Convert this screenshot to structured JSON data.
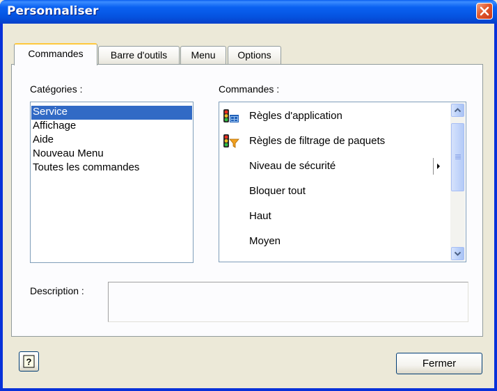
{
  "window": {
    "title": "Personnaliser"
  },
  "tabs": [
    {
      "label": "Commandes",
      "active": true
    },
    {
      "label": "Barre d'outils",
      "active": false
    },
    {
      "label": "Menu",
      "active": false
    },
    {
      "label": "Options",
      "active": false
    }
  ],
  "categories": {
    "label": "Catégories :",
    "items": [
      "Service",
      "Affichage",
      "Aide",
      "Nouveau Menu",
      "Toutes les commandes"
    ],
    "selected": "Service"
  },
  "commands": {
    "label": "Commandes :",
    "items": [
      {
        "label": "Règles d'application",
        "icon": "application-rules-icon"
      },
      {
        "label": "Règles de filtrage de paquets",
        "icon": "packet-filter-icon"
      },
      {
        "label": "Niveau de sécurité",
        "icon": "",
        "submenu": true
      },
      {
        "label": "Bloquer tout",
        "icon": ""
      },
      {
        "label": "Haut",
        "icon": ""
      },
      {
        "label": "Moyen",
        "icon": ""
      }
    ]
  },
  "description": {
    "label": "Description :",
    "value": ""
  },
  "buttons": {
    "help_icon": "help-question-icon",
    "close": "Fermer"
  },
  "colors": {
    "titlebar": "#0A62F2",
    "selection": "#316AC5",
    "close": "#E2582B",
    "tab_accent": "#FFC83C"
  }
}
